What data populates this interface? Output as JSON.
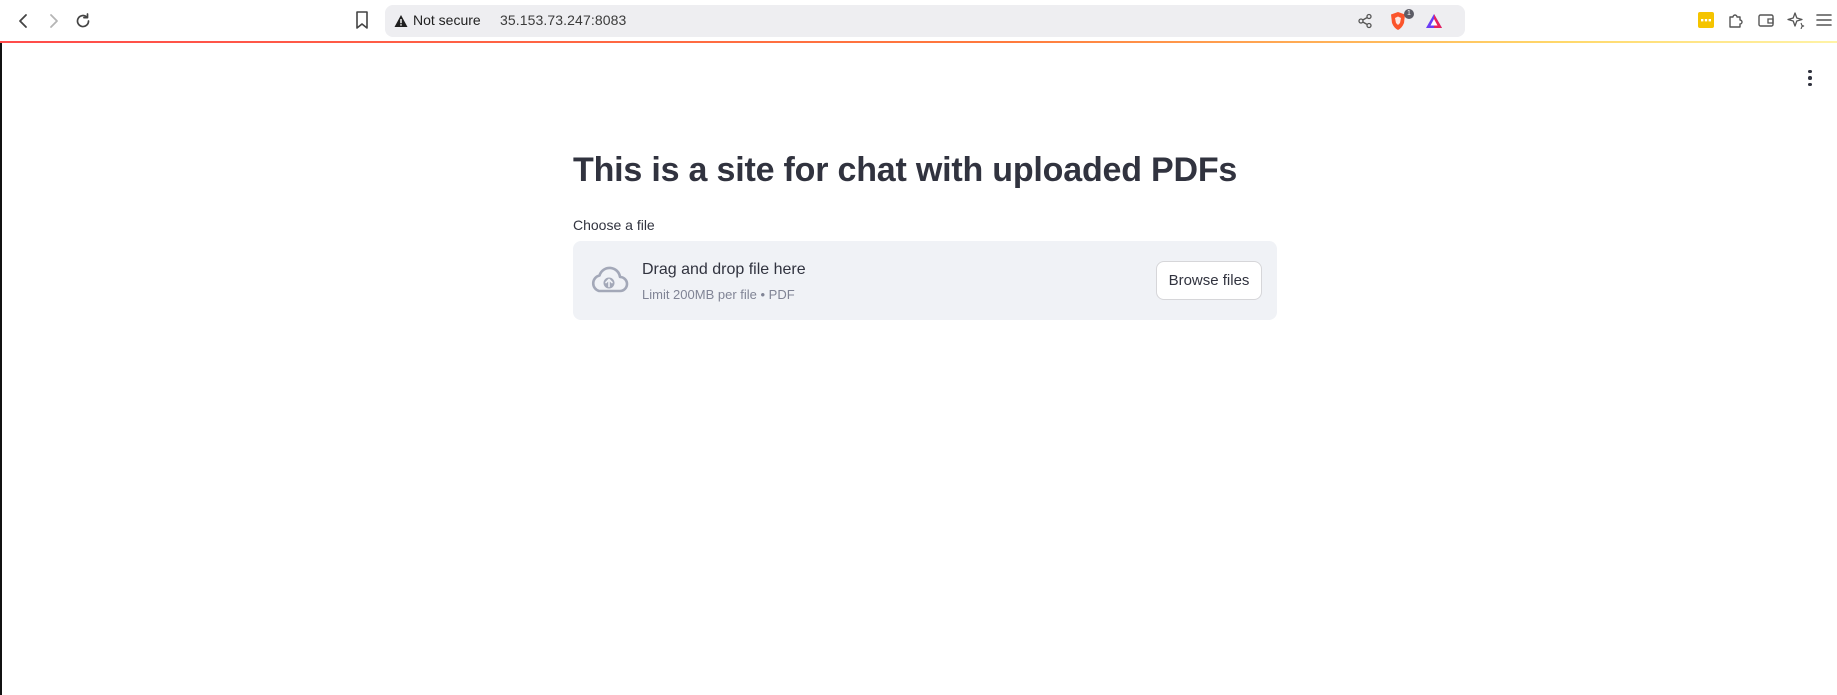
{
  "browser": {
    "url_security": "Not secure",
    "url": "35.153.73.247:8083",
    "shield_count": "1"
  },
  "page": {
    "title": "This is a site for chat with uploaded PDFs",
    "file_label": "Choose a file",
    "dropzone": {
      "instruction": "Drag and drop file here",
      "limit": "Limit 200MB per file • PDF",
      "browse_label": "Browse files"
    }
  },
  "colors": {
    "text": "#31333f",
    "dropzone_bg": "#f0f2f6",
    "accent_start": "#ff4b4b",
    "accent_end": "#fff3a6"
  },
  "icons": [
    "back-arrow-icon",
    "forward-arrow-icon",
    "reload-icon",
    "bookmark-icon",
    "warning-icon",
    "share-icon",
    "brave-shield-icon",
    "brave-rewards-icon",
    "extension-yellow-icon",
    "puzzle-icon",
    "wallet-icon",
    "leo-ai-icon",
    "hamburger-menu-icon",
    "kebab-menu-icon",
    "cloud-upload-icon"
  ]
}
